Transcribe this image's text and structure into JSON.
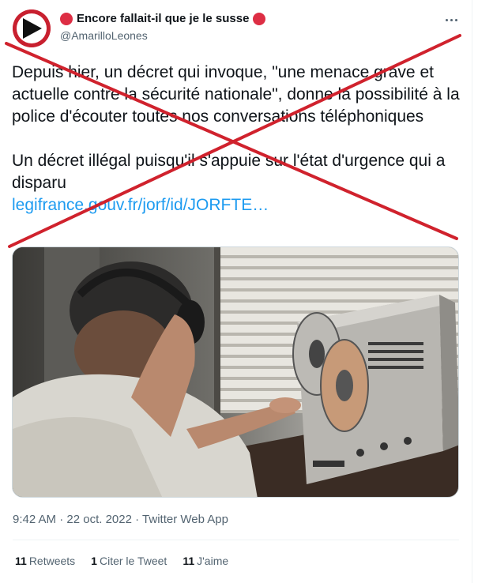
{
  "tweet": {
    "display_name": "Encore fallait-il que je le susse",
    "handle": "@AmarilloLeones",
    "paragraph1": "Depuis hier, un décret qui invoque, \"une menace grave et actuelle contre la sécurité nationale\", donne la possibilité à la police d'écouter toutes nos conversations téléphoniques",
    "paragraph2": "Un décret illégal puisqu'il s'appuie sur l'état d'urgence qui a disparu",
    "link_text": "legifrance.gouv.fr/jorf/id/JORFTE…",
    "time": "9:42 AM",
    "date": "22 oct. 2022",
    "source": "Twitter Web App",
    "separator": "·",
    "media_icon": "photo-reel-to-reel-tape-recorder"
  },
  "stats": {
    "retweets_count": "11",
    "retweets_label": "Retweets",
    "quotes_count": "1",
    "quotes_label": "Citer le Tweet",
    "likes_count": "11",
    "likes_label": "J'aime"
  },
  "icons": {
    "name_emoji": "red-circle-icon",
    "more": "more-icon",
    "avatar": "play-triangle-avatar"
  },
  "colors": {
    "link": "#1d9bf0",
    "cross": "#d0222d",
    "emoji_red": "#dd2e44",
    "avatar_red": "#c8202f"
  }
}
